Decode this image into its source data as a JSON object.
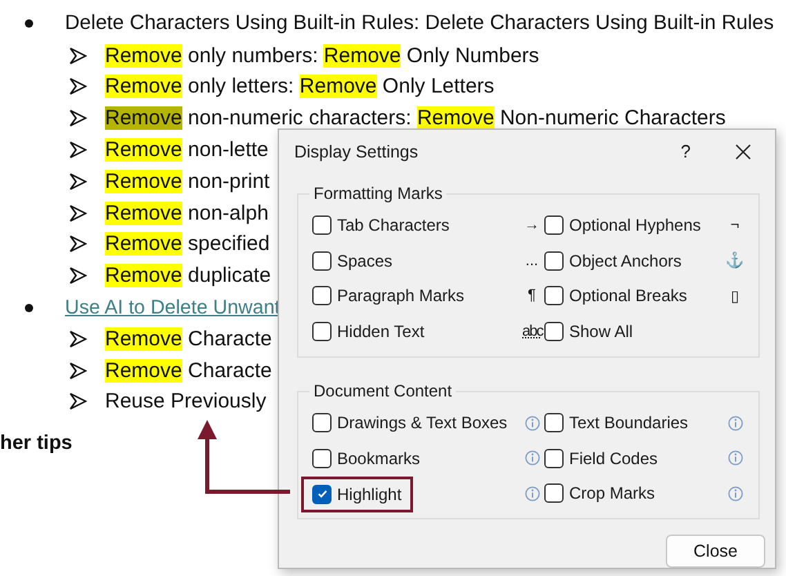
{
  "document": {
    "sections": [
      {
        "heading": "Delete Characters Using Built-in Rules: Delete Characters Using Built-in Rules",
        "link": false,
        "items": [
          {
            "parts": [
              {
                "text": "Remove",
                "color": "#ffff00"
              },
              {
                "text": " only numbers: "
              },
              {
                "text": "Remove",
                "color": "#ffff00"
              },
              {
                "text": " Only Numbers"
              }
            ]
          },
          {
            "parts": [
              {
                "text": "Remove",
                "color": "#ffff00"
              },
              {
                "text": " only letters: "
              },
              {
                "text": "Remove",
                "color": "#ffff00"
              },
              {
                "text": " Only Letters"
              }
            ]
          },
          {
            "parts": [
              {
                "text": "Remove",
                "color": "#b5b500"
              },
              {
                "text": " non-numeric characters: "
              },
              {
                "text": "Remove",
                "color": "#ffff00"
              },
              {
                "text": " Non-numeric Characters"
              }
            ]
          },
          {
            "parts": [
              {
                "text": "Remove",
                "color": "#ffff00"
              },
              {
                "text": " non-lette"
              }
            ]
          },
          {
            "parts": [
              {
                "text": "Remove",
                "color": "#ffff00"
              },
              {
                "text": " non-print"
              }
            ]
          },
          {
            "parts": [
              {
                "text": "Remove",
                "color": "#ffff00"
              },
              {
                "text": " non-alph"
              }
            ]
          },
          {
            "parts": [
              {
                "text": "Remove",
                "color": "#ffff00"
              },
              {
                "text": " specified"
              }
            ]
          },
          {
            "parts": [
              {
                "text": "Remove",
                "color": "#ffff00"
              },
              {
                "text": " duplicate"
              }
            ]
          }
        ]
      },
      {
        "heading": "Use AI to Delete Unwant",
        "link": true,
        "items": [
          {
            "parts": [
              {
                "text": "Remove",
                "color": "#ffff00"
              },
              {
                "text": " Characte"
              }
            ]
          },
          {
            "parts": [
              {
                "text": "Remove",
                "color": "#ffff00"
              },
              {
                "text": " Characte"
              }
            ]
          },
          {
            "parts": [
              {
                "text": "Reuse Previously"
              }
            ]
          }
        ]
      }
    ],
    "footer": "her tips"
  },
  "dialog": {
    "title": "Display Settings",
    "help": "?",
    "formatting_marks": {
      "title": "Formatting Marks",
      "options": [
        {
          "label": "Tab Characters",
          "checked": false,
          "symbol": "→"
        },
        {
          "label": "Optional Hyphens",
          "checked": false,
          "symbol": "¬"
        },
        {
          "label": "Spaces",
          "checked": false,
          "symbol": "..."
        },
        {
          "label": "Object Anchors",
          "checked": false,
          "symbol": "⚓"
        },
        {
          "label": "Paragraph Marks",
          "checked": false,
          "symbol": "¶"
        },
        {
          "label": "Optional Breaks",
          "checked": false,
          "symbol": "▯"
        },
        {
          "label": "Hidden Text",
          "checked": false,
          "symbol": "abc"
        },
        {
          "label": "Show All",
          "checked": false
        }
      ]
    },
    "document_content": {
      "title": "Document Content",
      "options": [
        {
          "label": "Drawings & Text Boxes",
          "checked": false,
          "emphasized": false
        },
        {
          "label": "Text Boundaries",
          "checked": false,
          "emphasized": false
        },
        {
          "label": "Bookmarks",
          "checked": false,
          "emphasized": false
        },
        {
          "label": "Field Codes",
          "checked": false,
          "emphasized": false
        },
        {
          "label": "Highlight",
          "checked": true,
          "emphasized": true
        },
        {
          "label": "Crop Marks",
          "checked": false,
          "emphasized": false
        }
      ]
    },
    "buttons": [
      "Close"
    ]
  }
}
